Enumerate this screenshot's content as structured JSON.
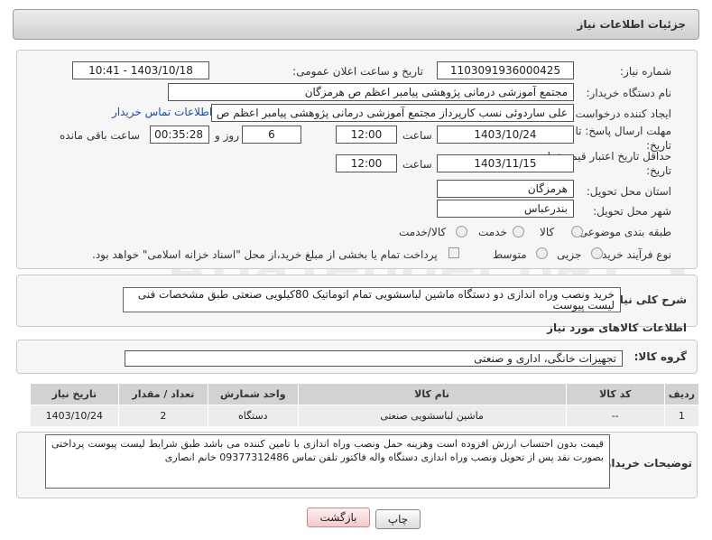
{
  "header": {
    "title": "جزئیات اطلاعات نیاز"
  },
  "need": {
    "number_label": "شماره نیاز:",
    "number_value": "1103091936000425",
    "announce_label": "تاریخ و ساعت اعلان عمومی:",
    "announce_value": "1403/10/18 - 10:41",
    "buyer_label": "نام دستگاه خریدار:",
    "buyer_value": "مجتمع آموزشی درمانی پژوهشی پیامبر اعظم ص  هرمزگان",
    "creator_label": "ایجاد کننده درخواست:",
    "creator_value": "علی ساردوئی نسب کارپرداز مجتمع آموزشی درمانی پژوهشی پیامبر اعظم ص",
    "contact_link": "اطلاعات تماس خریدار",
    "deadline_label_line1": "مهلت ارسال پاسخ: تا",
    "deadline_label_line2": "تاریخ:",
    "deadline_date": "1403/10/24",
    "time_label": "ساعت",
    "deadline_time": "12:00",
    "days_value": "6",
    "days_label": "روز و",
    "remaining_value": "00:35:28",
    "remaining_label": "ساعت باقی مانده",
    "validity_label_line1": "حداقل تاریخ اعتبار قیمت: تا",
    "validity_label_line2": "تاریخ:",
    "validity_date": "1403/11/15",
    "validity_time": "12:00",
    "province_label": "استان محل تحویل:",
    "province_value": "هرمزگان",
    "city_label": "شهر محل تحویل:",
    "city_value": "بندرعباس",
    "category_label": "طبقه بندی موضوعی:",
    "category_options": [
      "کالا",
      "خدمت",
      "کالا/خدمت"
    ],
    "process_label": "نوع فرآیند خرید :",
    "process_options": [
      "جزیی",
      "متوسط"
    ],
    "payment_note": "پرداخت تمام یا بخشی از مبلغ خرید،از محل \"اسناد خزانه اسلامی\" خواهد بود."
  },
  "description": {
    "label": "شرح کلی نیاز:",
    "text": "خرید ونصب وراه  اندازی دو دستگاه  ماشین  لباسشویی تمام اتوماتیک 80کیلویی صنعتی طبق  مشخصات فنی لیست پیوست"
  },
  "goods": {
    "section_title": "اطلاعات کالاهای مورد نیاز",
    "group_label": "گروه کالا:",
    "group_value": "تجهیزات خانگی، اداری و صنعتی",
    "columns": [
      "ردیف",
      "کد کالا",
      "نام کالا",
      "واحد شمارش",
      "تعداد / مقدار",
      "تاریخ نیاز"
    ],
    "rows": [
      [
        "1",
        "--",
        "ماشین لباسشویی صنعتی",
        "دستگاه",
        "2",
        "1403/10/24"
      ]
    ]
  },
  "buyer_notes": {
    "label": "توضیحات خریدار:",
    "text": "قیمت بدون احتساب ارزش افزوده است وهزینه حمل ونصب وراه اندازی با تامین کننده می باشد طبق شرایط لیست پیوست پرداختی بصورت نقد پس از تحویل ونصب وراه اندازی دستگاه واله فاکتور تلفن تماس 09377312486 خانم انصاری"
  },
  "actions": {
    "print_label": "چاپ",
    "back_label": "بازگشت"
  },
  "watermark": {
    "text": "AriaTender.neT"
  }
}
